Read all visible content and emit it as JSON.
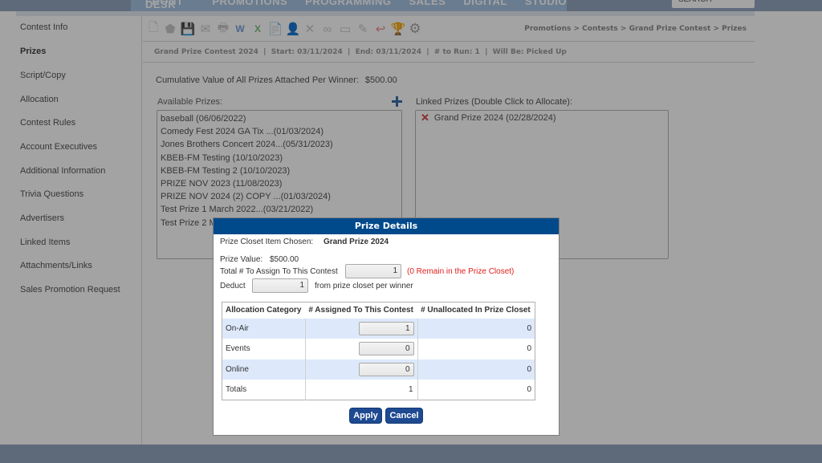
{
  "top_nav": {
    "items": [
      "FRONT DESK",
      "PROMOTIONS",
      "PROGRAMMING",
      "SALES",
      "DIGITAL",
      "STUDIO"
    ],
    "search_placeholder": "SEARCH"
  },
  "sidebar": {
    "items": [
      {
        "label": "Contest Info",
        "active": false
      },
      {
        "label": "Prizes",
        "active": true
      },
      {
        "label": "Script/Copy",
        "active": false
      },
      {
        "label": "Allocation",
        "active": false
      },
      {
        "label": "Contest Rules",
        "active": false
      },
      {
        "label": "Account Executives",
        "active": false
      },
      {
        "label": "Additional Information",
        "active": false
      },
      {
        "label": "Trivia Questions",
        "active": false
      },
      {
        "label": "Advertisers",
        "active": false
      },
      {
        "label": "Linked Items",
        "active": false
      },
      {
        "label": "Attachments/Links",
        "active": false
      },
      {
        "label": "Sales Promotion Request",
        "active": false
      }
    ]
  },
  "toolbar": {
    "icons": [
      "new-document-icon",
      "tag-icon",
      "save-icon",
      "email-icon",
      "print-icon",
      "word-export-icon",
      "excel-export-icon",
      "pdf-export-icon",
      "user-icon",
      "delete-icon",
      "link-icon",
      "toggle-icon",
      "edit-icon",
      "undo-icon",
      "trophy-icon",
      "settings-icon"
    ],
    "glyphs": [
      "🗋",
      "⬟",
      "💾",
      "✉",
      "🖶",
      "W",
      "X",
      "📄",
      "👤",
      "✕",
      "∞",
      "▭",
      "✎",
      "↩",
      "🏆",
      "⚙"
    ]
  },
  "breadcrumb": {
    "items": [
      "Promotions",
      "Contests",
      "Grand Prize Contest",
      "Prizes"
    ],
    "separator": " > "
  },
  "contest_info": {
    "name": "Grand Prize Contest 2024",
    "start": "Start: 03/11/2024",
    "end": "End: 03/11/2024",
    "to_run": "# to Run: 1",
    "will_be": "Will Be: Picked Up",
    "text": "Grand Prize Contest 2024  |  Start: 03/11/2024  |  End: 03/11/2024  |  # to Run: 1  |  Will Be: Picked Up"
  },
  "cumulative": {
    "label": "Cumulative Value of All Prizes Attached Per Winner:",
    "value": "$500.00"
  },
  "available_prizes": {
    "label": "Available Prizes:",
    "items": [
      "baseball (06/06/2022)",
      "Comedy Fest 2024 GA Tix ...(01/03/2024)",
      "Jones Brothers Concert 2024...(05/31/2023)",
      "KBEB-FM Testing (10/10/2023)",
      "KBEB-FM Testing 2 (10/10/2023)",
      "PRIZE NOV 2023 (11/08/2023)",
      "PRIZE NOV 2024 (2) COPY ...(01/03/2024)",
      "Test Prize 1 March 2022...(03/21/2022)",
      "Test Prize 2 M"
    ]
  },
  "linked_prizes": {
    "label": "Linked Prizes (Double Click to Allocate):",
    "items": [
      "Grand Prize 2024 (02/28/2024)"
    ]
  },
  "modal": {
    "title": "Prize Details",
    "closet_item_label": "Prize Closet Item Chosen:",
    "closet_item_value": "Grand Prize 2024",
    "prize_value_label": "Prize Value:",
    "prize_value": "$500.00",
    "total_assign_label": "Total # To Assign To This Contest",
    "total_assign_value": "1",
    "remain_note": "(0 Remain in the Prize Closet)",
    "deduct_label": "Deduct",
    "deduct_value": "1",
    "deduct_suffix": "from prize closet per winner",
    "table": {
      "headers": [
        "Allocation Category",
        "# Assigned To This Contest",
        "# Unallocated In Prize Closet"
      ],
      "rows": [
        {
          "category": "On-Air",
          "assigned": "1",
          "unallocated": "0"
        },
        {
          "category": "Events",
          "assigned": "0",
          "unallocated": "0"
        },
        {
          "category": "Online",
          "assigned": "0",
          "unallocated": "0"
        }
      ],
      "totals": {
        "label": "Totals",
        "assigned": "1",
        "unallocated": "0"
      }
    },
    "apply_label": "Apply",
    "cancel_label": "Cancel"
  },
  "colors": {
    "modal_header": "#004a8c",
    "button": "#1e4a92",
    "alert_red": "#e0201c",
    "row_shade": "#dde9fb"
  }
}
